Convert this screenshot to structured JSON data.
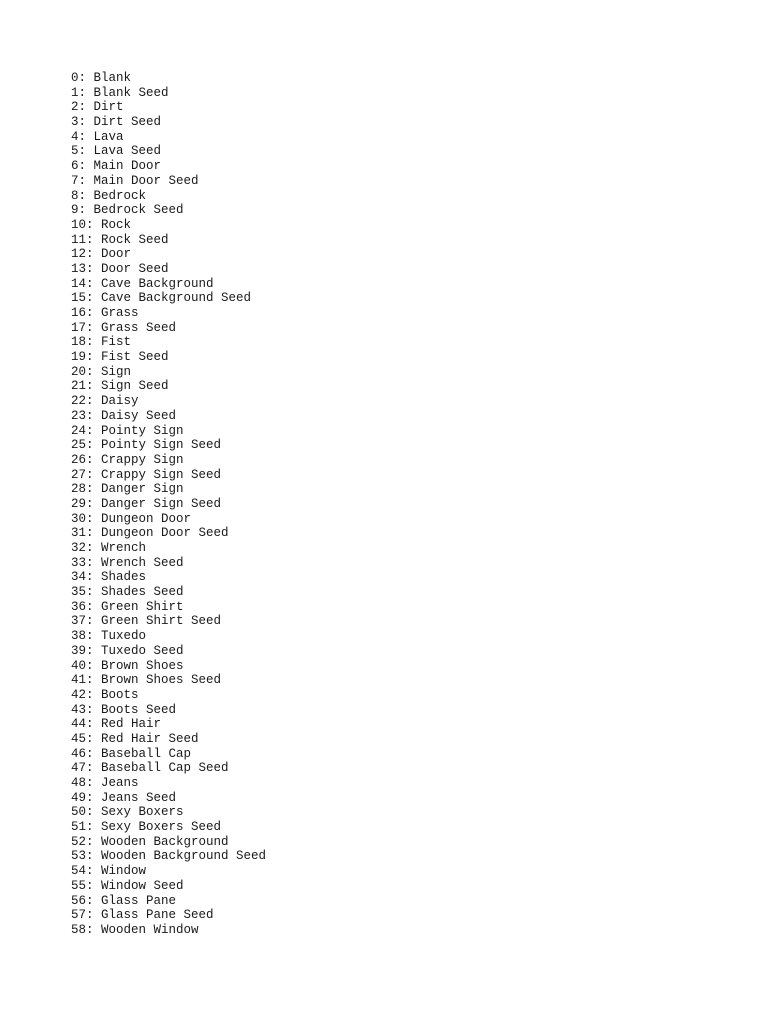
{
  "document": {
    "lines": [
      "0: Blank",
      "1: Blank Seed",
      "2: Dirt",
      "3: Dirt Seed",
      "4: Lava",
      "5: Lava Seed",
      "6: Main Door",
      "7: Main Door Seed",
      "8: Bedrock",
      "9: Bedrock Seed",
      "10: Rock",
      "11: Rock Seed",
      "12: Door",
      "13: Door Seed",
      "14: Cave Background",
      "15: Cave Background Seed",
      "16: Grass",
      "17: Grass Seed",
      "18: Fist",
      "19: Fist Seed",
      "20: Sign",
      "21: Sign Seed",
      "22: Daisy",
      "23: Daisy Seed",
      "24: Pointy Sign",
      "25: Pointy Sign Seed",
      "26: Crappy Sign",
      "27: Crappy Sign Seed",
      "28: Danger Sign",
      "29: Danger Sign Seed",
      "30: Dungeon Door",
      "31: Dungeon Door Seed",
      "32: Wrench",
      "33: Wrench Seed",
      "34: Shades",
      "35: Shades Seed",
      "36: Green Shirt",
      "37: Green Shirt Seed",
      "38: Tuxedo",
      "39: Tuxedo Seed",
      "40: Brown Shoes",
      "41: Brown Shoes Seed",
      "42: Boots",
      "43: Boots Seed",
      "44: Red Hair",
      "45: Red Hair Seed",
      "46: Baseball Cap",
      "47: Baseball Cap Seed",
      "48: Jeans",
      "49: Jeans Seed",
      "50: Sexy Boxers",
      "51: Sexy Boxers Seed",
      "52: Wooden Background",
      "53: Wooden Background Seed",
      "54: Window",
      "55: Window Seed",
      "56: Glass Pane",
      "57: Glass Pane Seed",
      "58: Wooden Window"
    ]
  }
}
